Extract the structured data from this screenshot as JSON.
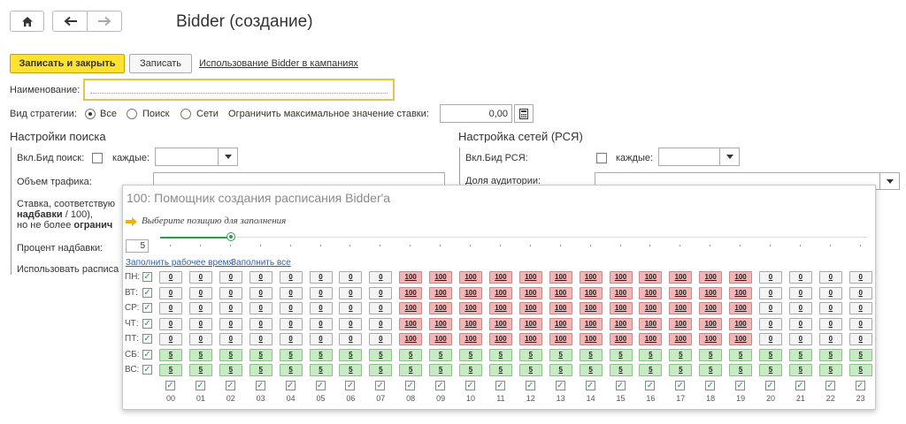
{
  "window": {
    "title": "Bidder (создание)"
  },
  "toolbar": {
    "save_close": "Записать и закрыть",
    "save": "Записать",
    "usage_link": "Использование Bidder в кампаниях"
  },
  "form": {
    "name_label": "Наименование:",
    "name_value": "",
    "strategy_label": "Вид стратегии:",
    "strategy_options": [
      "Все",
      "Поиск",
      "Сети"
    ],
    "strategy_selected": "Все",
    "max_bid_label": "Ограничить максимальное значение ставки:",
    "max_bid_value": "0,00"
  },
  "search_settings": {
    "title": "Настройки поиска",
    "enable_label": "Вкл.Бид поиск:",
    "every_label": "каждые:",
    "traffic_label": "Объем трафика:",
    "bid_line1": "Ставка, соответствую",
    "bid_line2_bold": "надбавки",
    "bid_line2_rest": " / 100),",
    "bid_line3_prefix": "но не более ",
    "bid_line3_bold": "огранич",
    "percent_label": "Процент надбавки:",
    "schedule_label": "Использовать расписа"
  },
  "network_settings": {
    "title": "Настройка сетей (РСЯ)",
    "enable_label": "Вкл.Бид РСЯ:",
    "every_label": "каждые:",
    "audience_label": "Доля аудитории:"
  },
  "popup": {
    "title": "100: Помощник создания расписания Bidder'а",
    "hint": "Выберите позицию для заполнения",
    "position_value": "5",
    "slider_fraction": 0.1,
    "fill_work_link": "Заполнить рабочее время",
    "fill_all_link": "Заполнить все",
    "days": [
      {
        "label": "ПН:",
        "values": [
          "0",
          "0",
          "0",
          "0",
          "0",
          "0",
          "0",
          "0",
          "100",
          "100",
          "100",
          "100",
          "100",
          "100",
          "100",
          "100",
          "100",
          "100",
          "100",
          "100",
          "0",
          "0",
          "0",
          "0"
        ]
      },
      {
        "label": "ВТ:",
        "values": [
          "0",
          "0",
          "0",
          "0",
          "0",
          "0",
          "0",
          "0",
          "100",
          "100",
          "100",
          "100",
          "100",
          "100",
          "100",
          "100",
          "100",
          "100",
          "100",
          "100",
          "0",
          "0",
          "0",
          "0"
        ]
      },
      {
        "label": "СР:",
        "values": [
          "0",
          "0",
          "0",
          "0",
          "0",
          "0",
          "0",
          "0",
          "100",
          "100",
          "100",
          "100",
          "100",
          "100",
          "100",
          "100",
          "100",
          "100",
          "100",
          "100",
          "0",
          "0",
          "0",
          "0"
        ]
      },
      {
        "label": "ЧТ:",
        "values": [
          "0",
          "0",
          "0",
          "0",
          "0",
          "0",
          "0",
          "0",
          "100",
          "100",
          "100",
          "100",
          "100",
          "100",
          "100",
          "100",
          "100",
          "100",
          "100",
          "100",
          "0",
          "0",
          "0",
          "0"
        ]
      },
      {
        "label": "ПТ:",
        "values": [
          "0",
          "0",
          "0",
          "0",
          "0",
          "0",
          "0",
          "0",
          "100",
          "100",
          "100",
          "100",
          "100",
          "100",
          "100",
          "100",
          "100",
          "100",
          "100",
          "100",
          "0",
          "0",
          "0",
          "0"
        ]
      },
      {
        "label": "СБ:",
        "values": [
          "5",
          "5",
          "5",
          "5",
          "5",
          "5",
          "5",
          "5",
          "5",
          "5",
          "5",
          "5",
          "5",
          "5",
          "5",
          "5",
          "5",
          "5",
          "5",
          "5",
          "5",
          "5",
          "5",
          "5"
        ]
      },
      {
        "label": "ВС:",
        "values": [
          "5",
          "5",
          "5",
          "5",
          "5",
          "5",
          "5",
          "5",
          "5",
          "5",
          "5",
          "5",
          "5",
          "5",
          "5",
          "5",
          "5",
          "5",
          "5",
          "5",
          "5",
          "5",
          "5",
          "5"
        ]
      }
    ],
    "hours": [
      "00",
      "01",
      "02",
      "03",
      "04",
      "05",
      "06",
      "07",
      "08",
      "09",
      "10",
      "11",
      "12",
      "13",
      "14",
      "15",
      "16",
      "17",
      "18",
      "19",
      "20",
      "21",
      "22",
      "23"
    ],
    "colors": {
      "zero": "#f4f4f4",
      "hundred": "#f3b5b5",
      "five": "#c7ebc3",
      "check": "#2a9d4b"
    }
  }
}
